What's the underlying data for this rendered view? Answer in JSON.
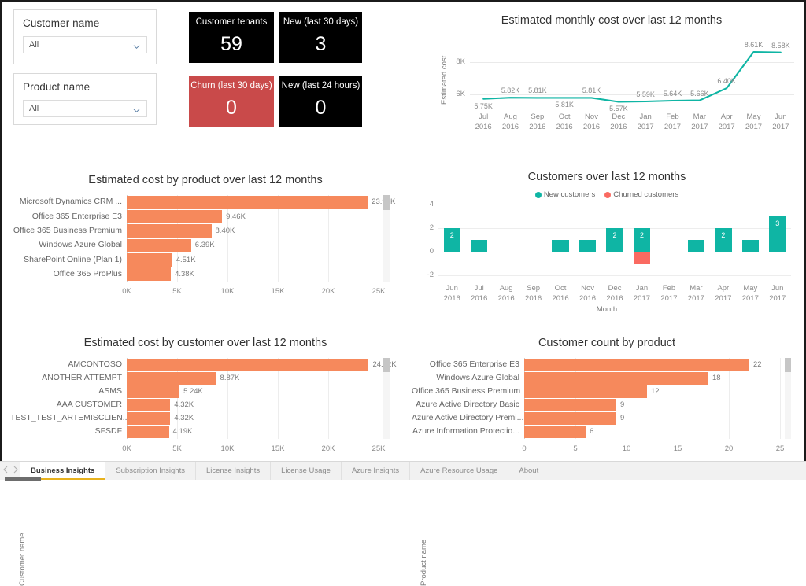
{
  "slicers": [
    {
      "title": "Customer name",
      "value": "All",
      "icon": "chevron-down-icon"
    },
    {
      "title": "Product name",
      "value": "All",
      "icon": "chevron-down-icon"
    }
  ],
  "kpis": [
    {
      "label": "Customer tenants",
      "value": "59",
      "style": "black"
    },
    {
      "label": "New (last 30 days)",
      "value": "3",
      "style": "black"
    },
    {
      "label": "Churn (last 30 days)",
      "value": "0",
      "style": "red"
    },
    {
      "label": "New (last 24 hours)",
      "value": "0",
      "style": "black"
    }
  ],
  "colors": {
    "bar_orange": "#f6895c",
    "line_teal": "#0fb5a4",
    "churn_red": "#fa6a61",
    "kpi_black": "#000000",
    "kpi_red": "#c94a4a",
    "tab_accent": "#e8b21e"
  },
  "tabs": {
    "prev_icon": "chevron-left-icon",
    "next_icon": "chevron-right-icon",
    "items": [
      {
        "label": "Business Insights",
        "active": true
      },
      {
        "label": "Subscription Insights",
        "active": false
      },
      {
        "label": "License Insights",
        "active": false
      },
      {
        "label": "License Usage",
        "active": false
      },
      {
        "label": "Azure Insights",
        "active": false
      },
      {
        "label": "Azure Resource Usage",
        "active": false
      },
      {
        "label": "About",
        "active": false
      }
    ]
  },
  "chart_data": [
    {
      "id": "monthly_cost",
      "type": "line",
      "title": "Estimated monthly cost over last 12 months",
      "xlabel": "",
      "ylabel": "Estimated cost",
      "ylim": [
        5400,
        8900
      ],
      "yticks": [
        "6K",
        "8K"
      ],
      "ytick_values": [
        6000,
        8000
      ],
      "grid": true,
      "categories": [
        "Jul\n2016",
        "Aug\n2016",
        "Sep\n2016",
        "Oct\n2016",
        "Nov\n2016",
        "Dec\n2016",
        "Jan\n2017",
        "Feb\n2017",
        "Mar\n2017",
        "Apr\n2017",
        "May\n2017",
        "Jun\n2017"
      ],
      "tick_labels": [
        {
          "m": "Jul",
          "y": "2016"
        },
        {
          "m": "Aug",
          "y": "2016"
        },
        {
          "m": "Sep",
          "y": "2016"
        },
        {
          "m": "Oct",
          "y": "2016"
        },
        {
          "m": "Nov",
          "y": "2016"
        },
        {
          "m": "Dec",
          "y": "2016"
        },
        {
          "m": "Jan",
          "y": "2017"
        },
        {
          "m": "Feb",
          "y": "2017"
        },
        {
          "m": "Mar",
          "y": "2017"
        },
        {
          "m": "Apr",
          "y": "2017"
        },
        {
          "m": "May",
          "y": "2017"
        },
        {
          "m": "Jun",
          "y": "2017"
        }
      ],
      "values": [
        5750,
        5820,
        5810,
        5810,
        5810,
        5570,
        5590,
        5640,
        5660,
        6400,
        8610,
        8580
      ],
      "data_labels": [
        "5.75K",
        "5.82K",
        "5.81K",
        "5.81K",
        "5.81K",
        "5.57K",
        "5.59K",
        "5.64K",
        "5.66K",
        "6.40K",
        "8.61K",
        "8.58K"
      ],
      "label_above": [
        false,
        true,
        true,
        false,
        true,
        false,
        true,
        true,
        true,
        true,
        true,
        true
      ],
      "series_color": "#0fb5a4"
    },
    {
      "id": "cost_by_product",
      "type": "bar",
      "title": "Estimated cost by product over last 12 months",
      "ylabel": "Product name",
      "xlabel": "",
      "xticks": [
        "0K",
        "5K",
        "10K",
        "15K",
        "20K",
        "25K"
      ],
      "xlim": [
        0,
        25000
      ],
      "categories": [
        "Microsoft Dynamics CRM ...",
        "Office 365 Enterprise E3",
        "Office 365 Business Premium",
        "Windows Azure Global",
        "SharePoint Online (Plan 1)",
        "Office 365 ProPlus"
      ],
      "values": [
        23920,
        9460,
        8400,
        6390,
        4510,
        4380
      ],
      "data_labels": [
        "23.92K",
        "9.46K",
        "8.40K",
        "6.39K",
        "4.51K",
        "4.38K"
      ],
      "bar_color": "#f6895c",
      "scrollbar": true
    },
    {
      "id": "customers_over_12_months",
      "type": "bar",
      "title": "Customers over last 12 months",
      "xlabel": "Month",
      "ylabel": "",
      "ylim": [
        -2,
        4
      ],
      "yticks": [
        "4",
        "2",
        "0",
        "-2"
      ],
      "ytick_values": [
        4,
        2,
        0,
        -2
      ],
      "legend_position": "top",
      "legend": [
        {
          "label": "New customers",
          "color": "#0fb5a4"
        },
        {
          "label": "Churned customers",
          "color": "#fa6a61"
        }
      ],
      "categories": [
        "Jun 2016",
        "Jul 2016",
        "Aug 2016",
        "Sep 2016",
        "Oct 2016",
        "Nov 2016",
        "Dec 2016",
        "Jan 2017",
        "Feb 2017",
        "Mar 2017",
        "Apr 2017",
        "May 2017",
        "Jun 2017"
      ],
      "tick_labels": [
        {
          "m": "Jun",
          "y": "2016"
        },
        {
          "m": "Jul",
          "y": "2016"
        },
        {
          "m": "Aug",
          "y": "2016"
        },
        {
          "m": "Sep",
          "y": "2016"
        },
        {
          "m": "Oct",
          "y": "2016"
        },
        {
          "m": "Nov",
          "y": "2016"
        },
        {
          "m": "Dec",
          "y": "2016"
        },
        {
          "m": "Jan",
          "y": "2017"
        },
        {
          "m": "Feb",
          "y": "2017"
        },
        {
          "m": "Mar",
          "y": "2017"
        },
        {
          "m": "Apr",
          "y": "2017"
        },
        {
          "m": "May",
          "y": "2017"
        },
        {
          "m": "Jun",
          "y": "2017"
        }
      ],
      "series": [
        {
          "name": "New customers",
          "color": "#0fb5a4",
          "values": [
            2,
            1,
            0,
            0,
            1,
            1,
            2,
            2,
            0,
            1,
            2,
            1,
            3
          ],
          "data_labels": [
            "2",
            "",
            "",
            "",
            "",
            "",
            "2",
            "2",
            "",
            "",
            "2",
            "",
            "3"
          ]
        },
        {
          "name": "Churned customers",
          "color": "#fa6a61",
          "values": [
            0,
            0,
            0,
            0,
            0,
            0,
            0,
            -1,
            0,
            0,
            0,
            0,
            0
          ],
          "data_labels": [
            "",
            "",
            "",
            "",
            "",
            "",
            "",
            "",
            "",
            "",
            "",
            "",
            ""
          ]
        }
      ]
    },
    {
      "id": "cost_by_customer",
      "type": "bar",
      "title": "Estimated cost by customer over last 12 months",
      "ylabel": "Customer name",
      "xlabel": "",
      "xticks": [
        "0K",
        "5K",
        "10K",
        "15K",
        "20K",
        "25K"
      ],
      "xlim": [
        0,
        25000
      ],
      "categories": [
        "AMCONTOSO",
        "ANOTHER ATTEMPT",
        "ASMS",
        "AAA CUSTOMER",
        "TEST_TEST_ARTEMISCLIEN...",
        "SFSDF"
      ],
      "values": [
        24020,
        8870,
        5240,
        4320,
        4320,
        4190
      ],
      "data_labels": [
        "24.02K",
        "8.87K",
        "5.24K",
        "4.32K",
        "4.32K",
        "4.19K"
      ],
      "bar_color": "#f6895c",
      "scrollbar": true
    },
    {
      "id": "customer_count_by_product",
      "type": "bar",
      "title": "Customer count by product",
      "ylabel": "Product name",
      "xlabel": "",
      "xticks": [
        "0",
        "5",
        "10",
        "15",
        "20",
        "25"
      ],
      "xlim": [
        0,
        25
      ],
      "categories": [
        "Office 365 Enterprise E3",
        "Windows Azure Global",
        "Office 365 Business Premium",
        "Azure Active Directory Basic",
        "Azure Active Directory Premi...",
        "Azure Information Protectio..."
      ],
      "values": [
        22,
        18,
        12,
        9,
        9,
        6
      ],
      "data_labels": [
        "22",
        "18",
        "12",
        "9",
        "9",
        "6"
      ],
      "bar_color": "#f6895c",
      "scrollbar": true
    }
  ]
}
